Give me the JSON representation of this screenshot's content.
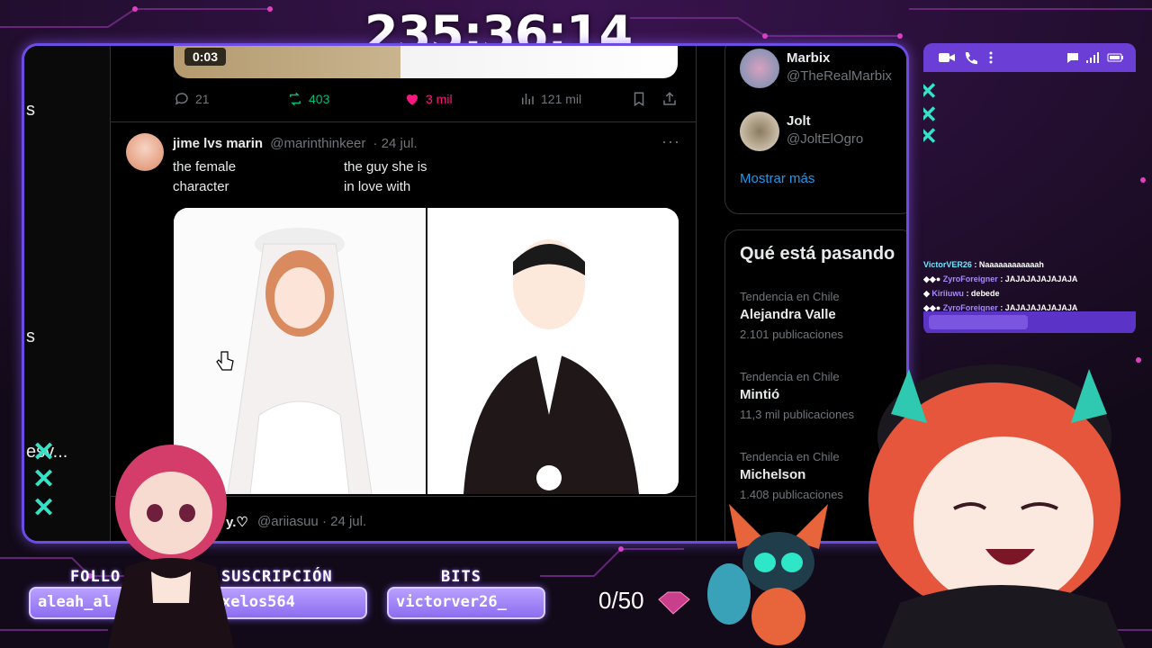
{
  "timer": "235:36:14",
  "left_fragments": [
    "s",
    "s",
    "esv..."
  ],
  "video": {
    "time": "0:03"
  },
  "tweet_actions": {
    "replies": "21",
    "reposts": "403",
    "likes": "3 mil",
    "views": "121 mil"
  },
  "tweet": {
    "name": "jime lvs marin",
    "handle": "@marinthinkeer",
    "date": "· 24 jul.",
    "text_left": [
      "the female",
      "character"
    ],
    "text_right": [
      "the guy she is",
      "in love with"
    ],
    "more_label": "···"
  },
  "next_tweet": {
    "name_fragment": "y.♡",
    "handle": "@ariiasuu",
    "date": "· 24 jul."
  },
  "who_to_follow": {
    "items": [
      {
        "name": "Marbix",
        "handle": "@TheRealMarbix"
      },
      {
        "name": "Jolt",
        "handle": "@JoltElOgro"
      }
    ],
    "show_more": "Mostrar más"
  },
  "trends": {
    "title": "Qué está pasando",
    "items": [
      {
        "context": "Tendencia en Chile",
        "topic": "Alejandra Valle",
        "count": "2.101 publicaciones"
      },
      {
        "context": "Tendencia en Chile",
        "topic": "Mintió",
        "count": "11,3 mil publicaciones"
      },
      {
        "context": "Tendencia en Chile",
        "topic": "Michelson",
        "count": "1.408 publicaciones"
      }
    ]
  },
  "chat": {
    "messages": [
      {
        "user": "VictorVER26",
        "text": ": Naaaaaaaaaaaah"
      },
      {
        "user": "ZyroForeigner",
        "text": ": JAJAJAJAJAJAJA"
      },
      {
        "user": "Kiriiuwu",
        "text": ": debede"
      },
      {
        "user": "ZyroForeigner",
        "text": ": JAJAJAJAJAJAJA"
      }
    ]
  },
  "overlay": {
    "follow_label": "FOLLO",
    "follow_value": "aleah_al",
    "sub_label": "SUSCRIPCIÓN",
    "sub_value": "xelos564",
    "bits_label": "BITS",
    "bits_value": "victorver26_",
    "goal": "0/50"
  },
  "colors": {
    "accent": "#6b4de6",
    "teal": "#35e2c7",
    "x_blue": "#1d9bf0",
    "like": "#f91880",
    "repost": "#00ba7c"
  }
}
